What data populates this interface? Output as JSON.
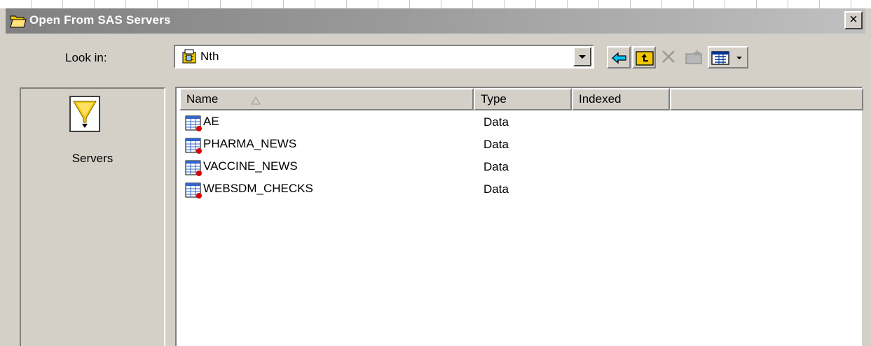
{
  "dialog": {
    "title": "Open From SAS Servers",
    "close_label": "×"
  },
  "lookin": {
    "label": "Look in:",
    "value": "Nth"
  },
  "toolbar": {
    "buttons": [
      "back-icon",
      "up-folder-icon",
      "delete-icon",
      "new-folder-icon",
      "view-menu-icon",
      "chevron-down-icon"
    ]
  },
  "places": {
    "servers_label": "Servers"
  },
  "list": {
    "columns": {
      "name": "Name",
      "type": "Type",
      "indexed": "Indexed"
    },
    "rows": [
      {
        "name": "AE",
        "type": "Data"
      },
      {
        "name": "PHARMA_NEWS",
        "type": "Data"
      },
      {
        "name": "VACCINE_NEWS",
        "type": "Data"
      },
      {
        "name": "WEBSDM_CHECKS",
        "type": "Data"
      }
    ]
  },
  "colors": {
    "title_bar": "#808080",
    "dialog_bg": "#d4d0c8",
    "folder_yellow": "#f0c800",
    "accent_cyan": "#00c8ff"
  }
}
